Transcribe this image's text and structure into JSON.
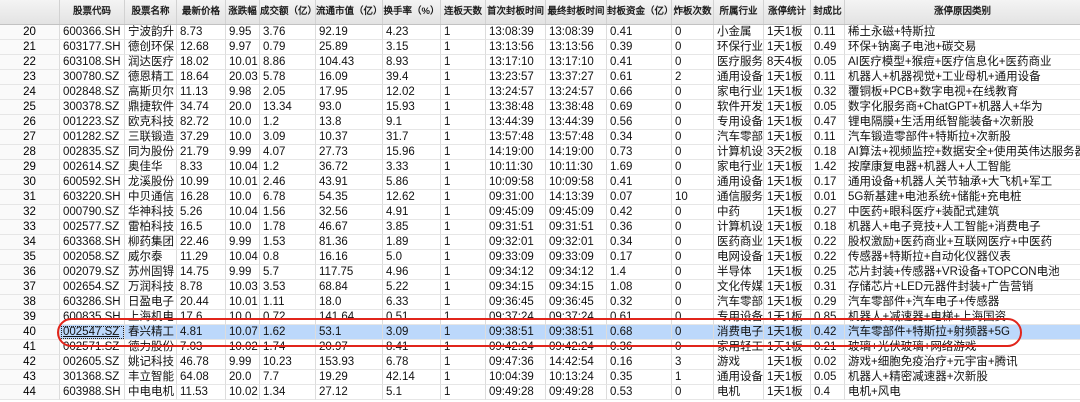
{
  "colors": {
    "selection": "#bcd8fb",
    "annotation": "#e1251b"
  },
  "header": [
    "股票代码",
    "股票名称",
    "最新价格",
    "涨跌幅",
    "成交额（亿）",
    "流通市值（亿）",
    "换手率（%）",
    "连板天数",
    "首次封板时间",
    "最终封板时间",
    "封板资金（亿）",
    "炸板次数",
    "所属行业",
    "涨停统计",
    "封成比",
    "涨停原因类别"
  ],
  "rows": [
    {
      "no": "20",
      "cells": [
        "600366.SH",
        "宁波韵升",
        "8.73",
        "9.95",
        "3.76",
        "92.19",
        "4.23",
        "1",
        "13:08:39",
        "13:08:39",
        "0.41",
        "0",
        "小金属",
        "1天1板",
        "0.11",
        "稀土永磁+特斯拉"
      ]
    },
    {
      "no": "21",
      "cells": [
        "603177.SH",
        "德创环保",
        "12.68",
        "9.97",
        "0.79",
        "25.89",
        "3.15",
        "1",
        "13:13:56",
        "13:13:56",
        "0.39",
        "0",
        "环保行业",
        "1天1板",
        "0.49",
        "环保+钠离子电池+碳交易"
      ]
    },
    {
      "no": "22",
      "cells": [
        "603108.SH",
        "润达医疗",
        "18.02",
        "10.01",
        "8.86",
        "104.43",
        "8.93",
        "1",
        "13:17:10",
        "13:17:10",
        "0.41",
        "0",
        "医疗服务",
        "8天4板",
        "0.05",
        "AI医疗模型+猴痘+医疗信息化+医药商业"
      ]
    },
    {
      "no": "23",
      "cells": [
        "300780.SZ",
        "德恩精工",
        "18.64",
        "20.03",
        "5.78",
        "16.09",
        "39.4",
        "1",
        "13:23:57",
        "13:37:27",
        "0.61",
        "2",
        "通用设备",
        "1天1板",
        "0.11",
        "机器人+机器视觉+工业母机+通用设备"
      ]
    },
    {
      "no": "24",
      "cells": [
        "002848.SZ",
        "高斯贝尔",
        "11.13",
        "9.98",
        "2.05",
        "17.95",
        "12.02",
        "1",
        "13:24:57",
        "13:24:57",
        "0.66",
        "0",
        "家电行业",
        "1天1板",
        "0.32",
        "覆铜板+PCB+数字电视+在线教育"
      ]
    },
    {
      "no": "25",
      "cells": [
        "300378.SZ",
        "鼎捷软件",
        "34.74",
        "20.0",
        "13.34",
        "93.0",
        "15.93",
        "1",
        "13:38:48",
        "13:38:48",
        "0.69",
        "0",
        "软件开发",
        "1天1板",
        "0.05",
        "数字化服务商+ChatGPT+机器人+华为"
      ]
    },
    {
      "no": "26",
      "cells": [
        "001223.SZ",
        "欧克科技",
        "82.72",
        "10.0",
        "1.2",
        "13.8",
        "9.1",
        "1",
        "13:44:39",
        "13:44:39",
        "0.56",
        "0",
        "专用设备",
        "1天1板",
        "0.47",
        "锂电隔膜+生活用纸智能装备+次新股"
      ]
    },
    {
      "no": "27",
      "cells": [
        "001282.SZ",
        "三联锻造",
        "37.29",
        "10.0",
        "3.09",
        "10.37",
        "31.7",
        "1",
        "13:57:48",
        "13:57:48",
        "0.34",
        "0",
        "汽车零部件",
        "1天1板",
        "0.11",
        "汽车锻造零部件+特斯拉+次新股"
      ]
    },
    {
      "no": "28",
      "cells": [
        "002835.SZ",
        "同为股份",
        "21.79",
        "9.99",
        "4.07",
        "27.73",
        "15.96",
        "1",
        "14:19:00",
        "14:19:00",
        "0.73",
        "0",
        "计算机设",
        "3天2板",
        "0.18",
        "AI算法+视频监控+数据安全+使用英伟达服务器"
      ]
    },
    {
      "no": "29",
      "cells": [
        "002614.SZ",
        "奥佳华",
        "8.33",
        "10.04",
        "1.2",
        "36.72",
        "3.33",
        "1",
        "10:11:30",
        "10:11:30",
        "1.69",
        "0",
        "家电行业",
        "1天1板",
        "1.42",
        "按摩康复电器+机器人+人工智能"
      ]
    },
    {
      "no": "30",
      "cells": [
        "600592.SH",
        "龙溪股份",
        "10.99",
        "10.01",
        "2.46",
        "43.91",
        "5.86",
        "1",
        "10:09:58",
        "10:09:58",
        "0.41",
        "0",
        "通用设备",
        "1天1板",
        "0.17",
        "通用设备+机器人关节轴承+大飞机+军工"
      ]
    },
    {
      "no": "31",
      "cells": [
        "603220.SH",
        "中贝通信",
        "16.28",
        "10.0",
        "6.78",
        "54.35",
        "12.62",
        "1",
        "09:31:00",
        "14:13:39",
        "0.07",
        "10",
        "通信服务",
        "1天1板",
        "0.01",
        "5G新基建+电池系统+储能+充电桩"
      ]
    },
    {
      "no": "32",
      "cells": [
        "000790.SZ",
        "华神科技",
        "5.26",
        "10.04",
        "1.56",
        "32.56",
        "4.91",
        "1",
        "09:45:09",
        "09:45:09",
        "0.42",
        "0",
        "中药",
        "1天1板",
        "0.27",
        "中医药+眼科医疗+装配式建筑"
      ]
    },
    {
      "no": "33",
      "cells": [
        "002577.SZ",
        "雷柏科技",
        "16.5",
        "10.0",
        "1.78",
        "46.67",
        "3.85",
        "1",
        "09:31:51",
        "09:31:51",
        "0.36",
        "0",
        "计算机设",
        "1天1板",
        "0.18",
        "机器人+电子竞技+人工智能+消费电子"
      ]
    },
    {
      "no": "34",
      "cells": [
        "603368.SH",
        "柳药集团",
        "22.46",
        "9.99",
        "1.53",
        "81.36",
        "1.89",
        "1",
        "09:32:01",
        "09:32:01",
        "0.34",
        "0",
        "医药商业",
        "1天1板",
        "0.22",
        "股权激励+医药商业+互联网医疗+中医药"
      ]
    },
    {
      "no": "35",
      "cells": [
        "002058.SZ",
        "威尔泰",
        "11.29",
        "10.04",
        "0.8",
        "16.16",
        "5.0",
        "1",
        "09:33:09",
        "09:33:09",
        "0.17",
        "0",
        "电网设备",
        "1天1板",
        "0.22",
        "传感器+特斯拉+自动化仪器仪表"
      ]
    },
    {
      "no": "36",
      "cells": [
        "002079.SZ",
        "苏州固锝",
        "14.75",
        "9.99",
        "5.7",
        "117.75",
        "4.96",
        "1",
        "09:34:12",
        "09:34:12",
        "1.4",
        "0",
        "半导体",
        "1天1板",
        "0.25",
        "芯片封装+传感器+VR设备+TOPCON电池"
      ]
    },
    {
      "no": "37",
      "cells": [
        "002654.SZ",
        "万润科技",
        "8.78",
        "10.03",
        "3.53",
        "68.84",
        "5.22",
        "1",
        "09:34:15",
        "09:34:15",
        "1.08",
        "0",
        "文化传媒",
        "1天1板",
        "0.31",
        "存储芯片+LED元器件封装+广告营销"
      ]
    },
    {
      "no": "38",
      "cells": [
        "603286.SH",
        "日盈电子",
        "20.44",
        "10.01",
        "1.11",
        "18.0",
        "6.33",
        "1",
        "09:36:45",
        "09:36:45",
        "0.32",
        "0",
        "汽车零部件",
        "1天1板",
        "0.29",
        "汽车零部件+汽车电子+传感器"
      ]
    },
    {
      "no": "39",
      "cells": [
        "600835.SH",
        "上海机电",
        "17.6",
        "10.0",
        "0.72",
        "141.64",
        "0.51",
        "1",
        "09:37:24",
        "09:37:24",
        "0.61",
        "0",
        "专用设备",
        "1天1板",
        "0.85",
        "机器人+减速器+电梯+上海国资"
      ]
    },
    {
      "no": "40",
      "selected": true,
      "cells": [
        "002547.SZ",
        "春兴精工",
        "4.81",
        "10.07",
        "1.62",
        "53.1",
        "3.09",
        "1",
        "09:38:51",
        "09:38:51",
        "0.68",
        "0",
        "消费电子",
        "1天1板",
        "0.42",
        "汽车零部件+特斯拉+射频器+5G"
      ]
    },
    {
      "no": "41",
      "cells": [
        "002571.SZ",
        "德力股份",
        "7.03",
        "10.02",
        "1.74",
        "20.97",
        "8.41",
        "1",
        "09:42:24",
        "09:42:24",
        "0.36",
        "0",
        "家用轻工",
        "1天1板",
        "0.21",
        "玻璃+光伏玻璃+网络游戏"
      ]
    },
    {
      "no": "42",
      "cells": [
        "002605.SZ",
        "姚记科技",
        "46.78",
        "9.99",
        "10.23",
        "153.93",
        "6.78",
        "1",
        "09:47:36",
        "14:42:54",
        "0.16",
        "3",
        "游戏",
        "1天1板",
        "0.02",
        "游戏+细胞免疫治疗+元宇宙+腾讯"
      ]
    },
    {
      "no": "43",
      "cells": [
        "301368.SZ",
        "丰立智能",
        "64.08",
        "20.0",
        "7.7",
        "19.29",
        "42.14",
        "1",
        "10:04:39",
        "10:13:24",
        "0.35",
        "1",
        "通用设备",
        "1天1板",
        "0.05",
        "机器人+精密减速器+次新股"
      ]
    },
    {
      "no": "44",
      "cells": [
        "603988.SH",
        "中电电机",
        "11.53",
        "10.02",
        "1.34",
        "27.12",
        "5.1",
        "1",
        "09:49:28",
        "09:49:28",
        "0.53",
        "0",
        "电机",
        "1天1板",
        "0.4",
        "电机+风电"
      ]
    }
  ]
}
